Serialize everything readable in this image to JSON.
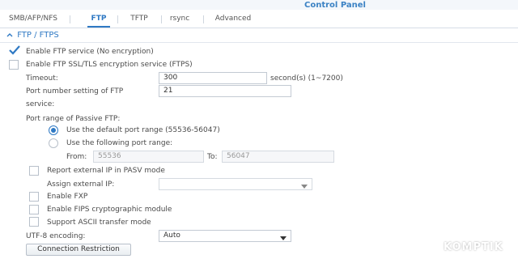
{
  "app": {
    "title": "Control Panel"
  },
  "tabs": [
    {
      "label": "SMB/AFP/NFS",
      "active": false
    },
    {
      "label": "FTP",
      "active": true
    },
    {
      "label": "TFTP",
      "active": false
    },
    {
      "label": "rsync",
      "active": false
    },
    {
      "label": "Advanced",
      "active": false
    }
  ],
  "section": {
    "title": "FTP / FTPS"
  },
  "form": {
    "enable_ftp": {
      "label": "Enable FTP service (No encryption)",
      "checked": true
    },
    "enable_ftps": {
      "label": "Enable FTP SSL/TLS encryption service (FTPS)",
      "checked": false
    },
    "timeout": {
      "label": "Timeout:",
      "value": "300",
      "unit": "second(s) (1~7200)"
    },
    "port": {
      "label_line1": "Port number setting of FTP",
      "label_line2": "service:",
      "value": "21"
    },
    "passive": {
      "label": "Port range of Passive FTP:",
      "default_option": "Use the default port range (55536-56047)",
      "custom_option": "Use the following port range:",
      "from_label": "From:",
      "from_value": "55536",
      "to_label": "To:",
      "to_value": "56047",
      "selected": "default"
    },
    "report_ip": {
      "label": "Report external IP in PASV mode",
      "checked": false
    },
    "assign_ip": {
      "label": "Assign external IP:",
      "value": ""
    },
    "enable_fxp": {
      "label": "Enable FXP",
      "checked": false
    },
    "enable_fips": {
      "label": "Enable FIPS cryptographic module",
      "checked": false
    },
    "ascii_mode": {
      "label": "Support ASCII transfer mode",
      "checked": false
    },
    "utf8": {
      "label": "UTF-8 encoding:",
      "value": "Auto"
    },
    "connection_button": "Connection Restriction"
  },
  "watermark": "KOMPTIK",
  "colors": {
    "accent": "#2f79c4",
    "title": "#3b82c4"
  }
}
